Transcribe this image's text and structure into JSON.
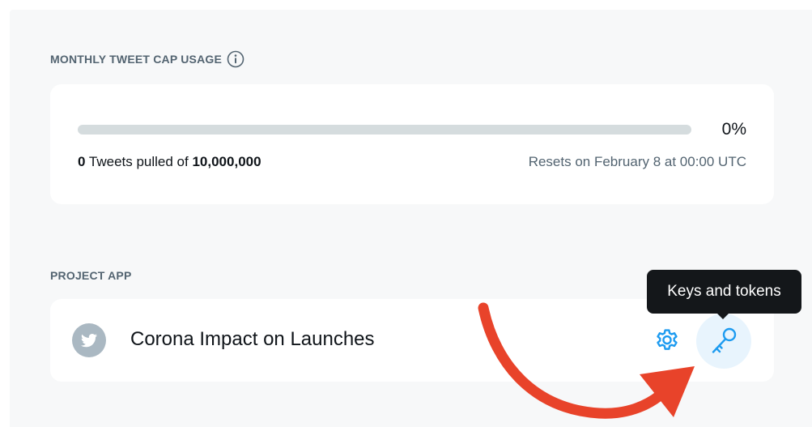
{
  "usage": {
    "heading": "MONTHLY TWEET CAP USAGE",
    "progress_fraction": 0,
    "percent_label": "0%",
    "pulled_count": "0",
    "pulled_text": " Tweets pulled of ",
    "cap": "10,000,000",
    "resets_text": "Resets on February 8 at 00:00 UTC"
  },
  "project_app": {
    "heading": "PROJECT APP",
    "app_name": "Corona Impact on Launches",
    "avatar_icon": "twitter-bird-icon",
    "settings_icon": "gear-icon",
    "keys_icon": "key-icon",
    "tooltip": "Keys and tokens"
  },
  "colors": {
    "accent": "#1d9bf0",
    "annotation_arrow": "#e8432a"
  }
}
